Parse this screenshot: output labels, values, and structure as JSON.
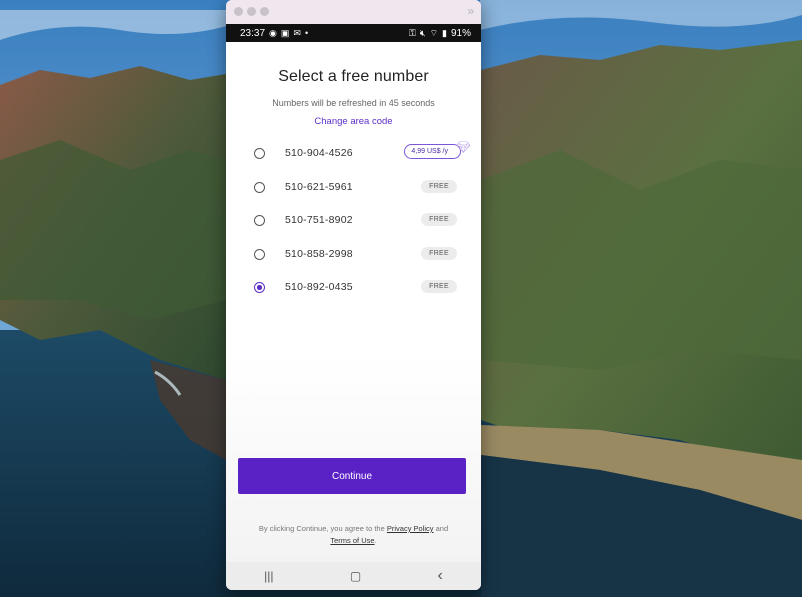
{
  "status_bar": {
    "time": "23:37",
    "battery": "91%",
    "left_icons": [
      "eye-icon",
      "image-icon",
      "mail-icon",
      "dot-icon"
    ],
    "right_icons": [
      "key-icon",
      "mute-icon",
      "wifi-icon",
      "signal-icon"
    ]
  },
  "screen": {
    "title": "Select a free number",
    "subtitle": "Numbers will be refreshed in 45 seconds",
    "change_link": "Change area code",
    "numbers": [
      {
        "number": "510-904-4526",
        "badge": "4,99 US$ /y",
        "premium": true,
        "selected": false
      },
      {
        "number": "510-621-5961",
        "badge": "FREE",
        "premium": false,
        "selected": false
      },
      {
        "number": "510-751-8902",
        "badge": "FREE",
        "premium": false,
        "selected": false
      },
      {
        "number": "510-858-2998",
        "badge": "FREE",
        "premium": false,
        "selected": false
      },
      {
        "number": "510-892-0435",
        "badge": "FREE",
        "premium": false,
        "selected": true
      }
    ],
    "continue_label": "Continue",
    "terms_prefix": "By clicking Continue, you agree to the",
    "privacy_link": "Privacy Policy",
    "terms_and": "and",
    "terms_link": "Terms of Use",
    "terms_suffix": "."
  },
  "nav_bar": {
    "recents_glyph": "|||",
    "home_glyph": "▢",
    "back_glyph": "‹"
  },
  "colors": {
    "accent": "#5a22c4",
    "link": "#5b2ec7"
  }
}
